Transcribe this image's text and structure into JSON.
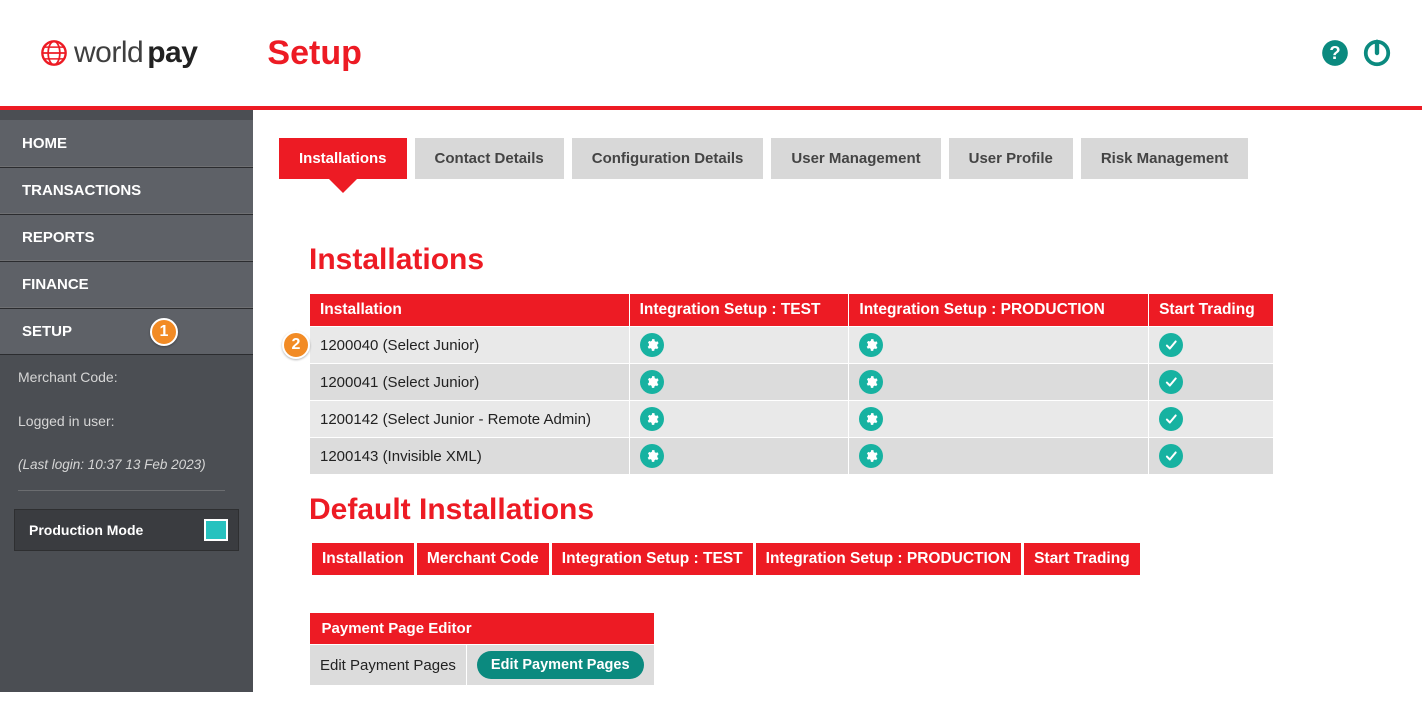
{
  "header": {
    "brand_world": "world",
    "brand_pay": "pay",
    "title": "Setup"
  },
  "sidebar": {
    "items": [
      "HOME",
      "TRANSACTIONS",
      "REPORTS",
      "FINANCE",
      "SETUP"
    ],
    "merchant_code_label": "Merchant Code:",
    "logged_in_label": "Logged in user:",
    "last_login_label": "(Last login: 10:37 13 Feb 2023)",
    "mode_label": "Production Mode"
  },
  "annotations": {
    "step1": "1",
    "step2": "2"
  },
  "tabs": [
    "Installations",
    "Contact Details",
    "Configuration Details",
    "User Management",
    "User Profile",
    "Risk Management"
  ],
  "installations": {
    "heading": "Installations",
    "columns": [
      "Installation",
      "Integration Setup : TEST",
      "Integration Setup : PRODUCTION",
      "Start Trading"
    ],
    "rows": [
      {
        "label": "1200040 (Select Junior)"
      },
      {
        "label": "1200041 (Select Junior)"
      },
      {
        "label": "1200142 (Select Junior - Remote Admin)"
      },
      {
        "label": "1200143 (Invisible XML)"
      }
    ]
  },
  "default_installations": {
    "heading": "Default Installations",
    "columns": [
      "Installation",
      "Merchant Code",
      "Integration Setup : TEST",
      "Integration Setup : PRODUCTION",
      "Start Trading"
    ]
  },
  "editor": {
    "heading": "Payment Page Editor",
    "row_label": "Edit Payment Pages",
    "button": "Edit Payment Pages"
  }
}
